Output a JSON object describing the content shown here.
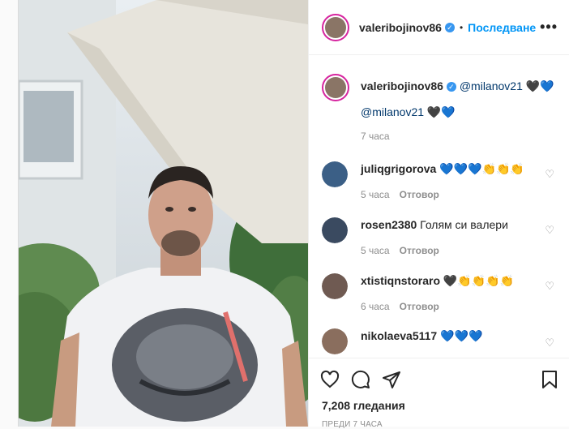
{
  "header": {
    "username": "valeribojinov86",
    "separator": "•",
    "follow_label": "Последване",
    "more_label": "•••"
  },
  "caption": {
    "username": "valeribojinov86",
    "mention1": "@milanov21",
    "emoji1": "🖤💙",
    "mention2": "@milanov21",
    "emoji2": "🖤💙",
    "time": "7 часа"
  },
  "comments": [
    {
      "username": "juliqgrigorova",
      "text": "💙💙💙👏👏👏",
      "time": "5 часа",
      "reply": "Отговор"
    },
    {
      "username": "rosen2380",
      "text": "Голям си валери",
      "time": "5 часа",
      "reply": "Отговор"
    },
    {
      "username": "xtistiqnstoraro",
      "text": "🖤👏👏👏👏",
      "time": "6 часа",
      "reply": "Отговор"
    },
    {
      "username": "nikolaeva5117",
      "text": "💙💙💙",
      "time": "",
      "reply": ""
    }
  ],
  "stats": {
    "views": "7,208 гледания",
    "posted": "ПРЕДИ 7 ЧАСА"
  },
  "icons": [
    "like-icon",
    "comment-icon",
    "share-icon",
    "save-icon",
    "verified-icon",
    "comment-heart-icon"
  ],
  "colors": {
    "accent": "#0095f6",
    "verified": "#3897f0",
    "story_ring": "#d6249f"
  }
}
